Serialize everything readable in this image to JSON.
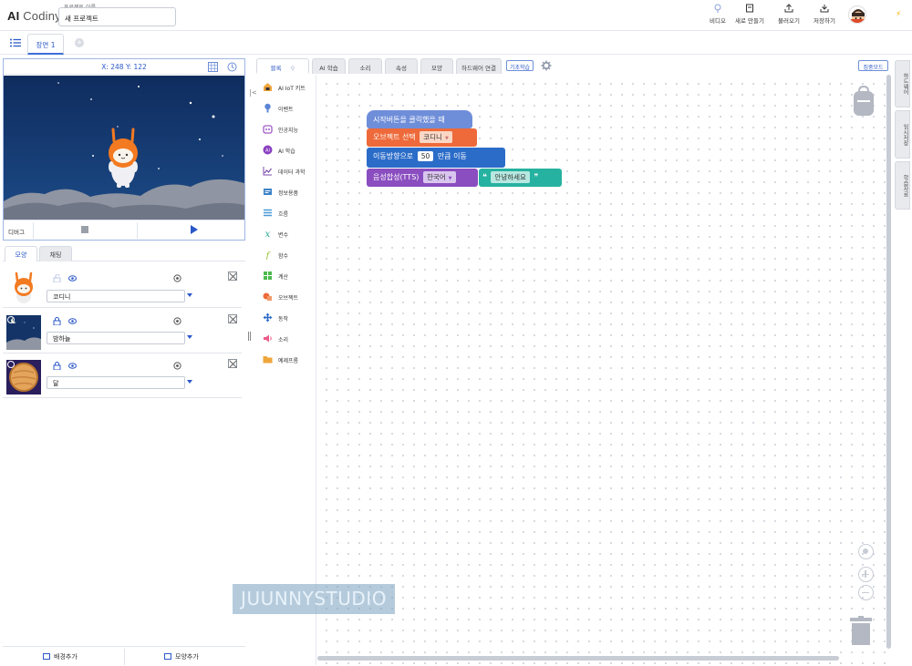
{
  "app": {
    "logo_ai": "AI",
    "logo_name": "Codiny"
  },
  "project": {
    "label": "프로젝트 이름",
    "name": "새 프로젝트"
  },
  "header_buttons": [
    {
      "label": "비디오",
      "icon": "video-icon"
    },
    {
      "label": "새로 만들기",
      "icon": "new-file-icon"
    },
    {
      "label": "불러오기",
      "icon": "upload-icon"
    },
    {
      "label": "저장하기",
      "icon": "save-icon"
    }
  ],
  "scene": {
    "tab_label": "장면 1"
  },
  "stage": {
    "coords": "X: 248 Y: 122",
    "debug_label": "디버그"
  },
  "object_tabs": [
    "모양",
    "채팅"
  ],
  "objects": [
    {
      "name": "코디니"
    },
    {
      "name": "밤하늘"
    },
    {
      "name": "달"
    }
  ],
  "bottom_buttons": {
    "add_background": "배경추가",
    "add_shape": "모양추가"
  },
  "category_tabs": [
    "블록",
    "AI 학습",
    "소리",
    "속성",
    "모양",
    "하드웨어 연결"
  ],
  "basic_tag": "기초학습",
  "focus_mode": "집중모드",
  "palette": [
    {
      "label": "AI IoT 키트",
      "color": "#f0a53b",
      "icon": "kit-icon"
    },
    {
      "label": "이벤트",
      "color": "#5b86d6",
      "icon": "event-icon"
    },
    {
      "label": "인공지능",
      "color": "#a05ac8",
      "icon": "ai-icon"
    },
    {
      "label": "AI 학습",
      "color": "#8a3fc0",
      "icon": "ai-learning-icon"
    },
    {
      "label": "데이터 과학",
      "color": "#7a4aa8",
      "icon": "data-science-icon"
    },
    {
      "label": "정보용품",
      "color": "#3a82c8",
      "icon": "info-icon"
    },
    {
      "label": "흐름",
      "color": "#4a9ad8",
      "icon": "flow-icon"
    },
    {
      "label": "변수",
      "color": "#2aa896",
      "icon": "variable-icon"
    },
    {
      "label": "함수",
      "color": "#9bc23a",
      "icon": "function-icon"
    },
    {
      "label": "계산",
      "color": "#4cba4c",
      "icon": "calculate-icon"
    },
    {
      "label": "오브젝트",
      "color": "#ee6a3a",
      "icon": "object-icon"
    },
    {
      "label": "동작",
      "color": "#2b6cc8",
      "icon": "motion-icon"
    },
    {
      "label": "소리",
      "color": "#ee5a8a",
      "icon": "sound-icon"
    },
    {
      "label": "예제프롬",
      "color": "#f0a53b",
      "icon": "example-icon"
    }
  ],
  "blocks": {
    "event": "시작버튼을 클릭했을 때",
    "object_prefix": "오브젝트 선택",
    "object_value": "코디니",
    "move_prefix": "이동방향으로",
    "move_value": "50",
    "move_suffix": "만큼 이동",
    "tts_prefix": "음성합성(TTS)",
    "tts_lang": "한국어",
    "tts_text": "안녕하세요",
    "quote_open": "❝",
    "quote_close": "❞"
  },
  "side_tabs": [
    "하드웨어",
    "임시저장",
    "학습자료"
  ],
  "watermark": "JUUNNYSTUDIO",
  "colors": {
    "accent": "#2b58c8",
    "event_block": "#6f8ed9",
    "object_block": "#ee6a3a",
    "motion_block": "#2b6cc8",
    "tts_block": "#8a4ec0",
    "tts_text_block": "#26b2a0",
    "stage_sky": "#0f2c5e"
  }
}
